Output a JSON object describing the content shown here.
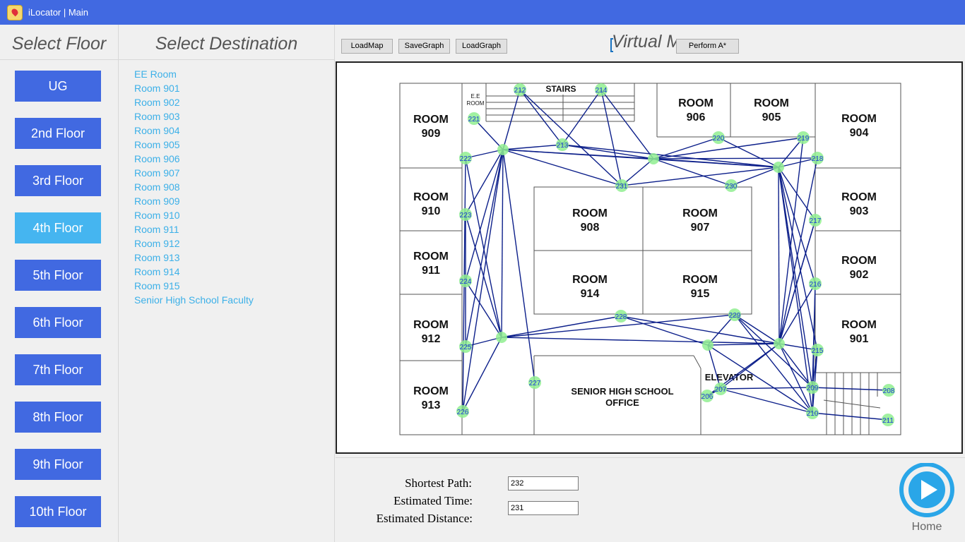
{
  "window": {
    "title": "iLocator | Main"
  },
  "floors": {
    "heading": "Select Floor",
    "items": [
      "UG",
      "2nd Floor",
      "3rd Floor",
      "4th Floor",
      "5th Floor",
      "6th Floor",
      "7th Floor",
      "8th Floor",
      "9th Floor",
      "10th Floor"
    ],
    "active": "4th Floor"
  },
  "destinations": {
    "heading": "Select Destination",
    "items": [
      "EE Room",
      "Room 901",
      "Room 902",
      "Room 903",
      "Room 904",
      "Room 905",
      "Room 906",
      "Room 907",
      "Room 908",
      "Room 909",
      "Room 910",
      "Room 911",
      "Room 912",
      "Room 913",
      "Room 914",
      "Room 915",
      "Senior High School Faculty"
    ]
  },
  "toolbar": {
    "load_map": "LoadMap",
    "save_graph": "SaveGraph",
    "load_graph": "LoadGraph",
    "perform": "Perform A*",
    "virtual_title": "Virtual Map"
  },
  "map": {
    "rooms": {
      "r909": [
        "ROOM",
        "909"
      ],
      "r910": [
        "ROOM",
        "910"
      ],
      "r911": [
        "ROOM",
        "911"
      ],
      "r912": [
        "ROOM",
        "912"
      ],
      "r913": [
        "ROOM",
        "913"
      ],
      "r906": [
        "ROOM",
        "906"
      ],
      "r905": [
        "ROOM",
        "905"
      ],
      "r904": [
        "ROOM",
        "904"
      ],
      "r903": [
        "ROOM",
        "903"
      ],
      "r902": [
        "ROOM",
        "902"
      ],
      "r901": [
        "ROOM",
        "901"
      ],
      "r908": [
        "ROOM",
        "908"
      ],
      "r907": [
        "ROOM",
        "907"
      ],
      "r914": [
        "ROOM",
        "914"
      ],
      "r915": [
        "ROOM",
        "915"
      ],
      "ee": [
        "E.E",
        "ROOM"
      ],
      "stairs": "STAIRS",
      "elevator": "ELEVATOR",
      "office": [
        "SENIOR HIGH SCHOOL",
        "OFFICE"
      ]
    },
    "nodes": [
      "212",
      "214",
      "221",
      "222",
      "223",
      "224",
      "225",
      "226",
      "227",
      "213",
      "231",
      "230",
      "220",
      "219",
      "218",
      "217",
      "216",
      "215",
      "228",
      "229",
      "208",
      "209",
      "210",
      "211",
      "206",
      "207"
    ],
    "colors": {
      "node": "#90ee90",
      "edge": "#0c1f8a",
      "label": "#1a3bd6"
    }
  },
  "results": {
    "shortest_path_label": "Shortest Path:",
    "estimated_time_label": "Estimated Time:",
    "estimated_distance_label": "Estimated Distance:",
    "shortest_path_value": "232",
    "estimated_time_value": "231"
  },
  "home": {
    "label": "Home",
    "color": "#2aa6e8"
  }
}
